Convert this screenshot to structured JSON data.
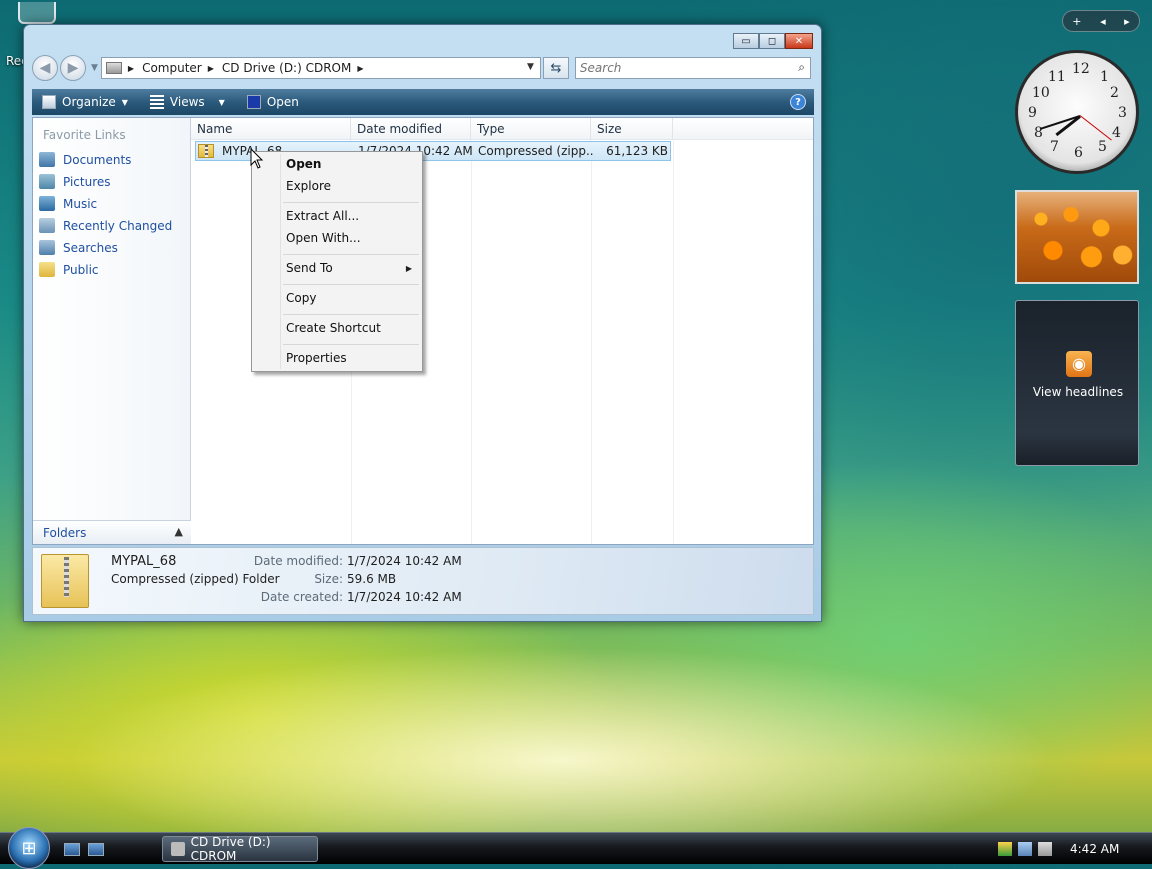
{
  "desktop": {
    "recycle_label": "Rec"
  },
  "window": {
    "caption_buttons": {
      "minimize": "▭",
      "maximize": "◻",
      "close": "✕"
    },
    "address": {
      "crumbs": [
        "Computer",
        "CD Drive (D:) CDROM"
      ]
    },
    "search": {
      "placeholder": "Search"
    },
    "toolbar": {
      "organize": "Organize",
      "views": "Views",
      "open": "Open",
      "help": "?"
    },
    "sidebar": {
      "title": "Favorite Links",
      "links": [
        "Documents",
        "Pictures",
        "Music",
        "Recently Changed",
        "Searches",
        "Public"
      ],
      "folders": "Folders"
    },
    "columns": [
      "Name",
      "Date modified",
      "Type",
      "Size"
    ],
    "files": [
      {
        "name": "MYPAL_68",
        "date": "1/7/2024 10:42 AM",
        "type": "Compressed (zipp...",
        "size": "61,123 KB"
      }
    ],
    "details": {
      "name": "MYPAL_68",
      "type": "Compressed (zipped) Folder",
      "date_modified_label": "Date modified:",
      "date_modified": "1/7/2024 10:42 AM",
      "size_label": "Size:",
      "size": "59.6 MB",
      "date_created_label": "Date created:",
      "date_created": "1/7/2024 10:42 AM"
    }
  },
  "context_menu": {
    "open": "Open",
    "explore": "Explore",
    "extract_all": "Extract All...",
    "open_with": "Open With...",
    "send_to": "Send To",
    "copy": "Copy",
    "create_shortcut": "Create Shortcut",
    "properties": "Properties"
  },
  "gadgets": {
    "bar": {
      "add": "+",
      "prev": "◂",
      "next": "▸"
    },
    "clock_numbers": [
      "12",
      "1",
      "2",
      "3",
      "4",
      "5",
      "6",
      "7",
      "8",
      "9",
      "10",
      "11"
    ],
    "feed_label": "View headlines"
  },
  "taskbar": {
    "window_button": "CD Drive (D:) CDROM",
    "time": "4:42 AM"
  },
  "colors": {
    "link": "#1f4f9f",
    "toolbar": "#2b5a7c",
    "selection": "#cde6f7"
  }
}
